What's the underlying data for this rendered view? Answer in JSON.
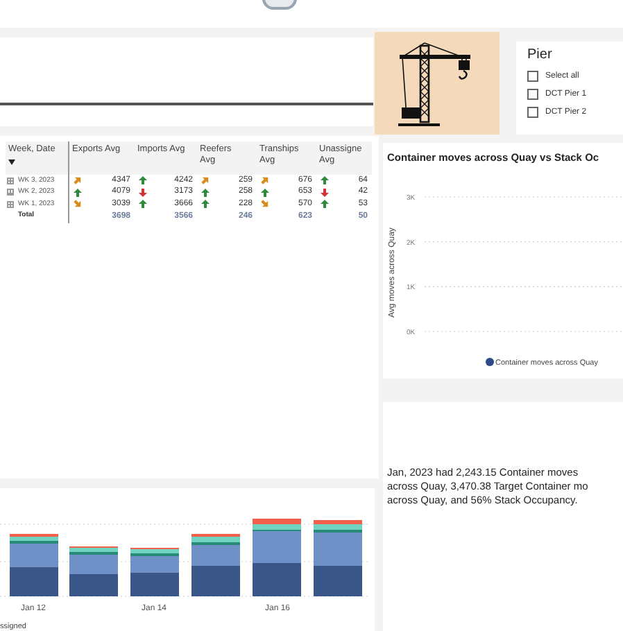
{
  "pier_slicer": {
    "title": "Pier",
    "options": [
      {
        "label": "Select all",
        "checked": false
      },
      {
        "label": "DCT Pier 1",
        "checked": false
      },
      {
        "label": "DCT Pier 2",
        "checked": false
      }
    ]
  },
  "table": {
    "columns": [
      "Week, Date",
      "Exports Avg",
      "Imports Avg",
      "Reefers Avg",
      "Tranships Avg",
      "Unassigne Avg"
    ],
    "rows": [
      {
        "label": "WK 3, 2023",
        "expanded": false,
        "cells": [
          {
            "value": "4347",
            "kind": "rising"
          },
          {
            "value": "4242",
            "kind": "up"
          },
          {
            "value": "259",
            "kind": "rising"
          },
          {
            "value": "676",
            "kind": "rising"
          },
          {
            "value": "64",
            "kind": "up"
          }
        ]
      },
      {
        "label": "WK 2, 2023",
        "expanded": false,
        "cells": [
          {
            "value": "4079",
            "kind": "up"
          },
          {
            "value": "3173",
            "kind": "down"
          },
          {
            "value": "258",
            "kind": "up"
          },
          {
            "value": "653",
            "kind": "up"
          },
          {
            "value": "42",
            "kind": "down"
          }
        ]
      },
      {
        "label": "WK 1, 2023",
        "expanded": false,
        "cells": [
          {
            "value": "3039",
            "kind": "falling"
          },
          {
            "value": "3666",
            "kind": "up"
          },
          {
            "value": "228",
            "kind": "up"
          },
          {
            "value": "570",
            "kind": "falling"
          },
          {
            "value": "53",
            "kind": "up"
          }
        ]
      }
    ],
    "total": {
      "label": "Total",
      "cells": [
        "3698",
        "3566",
        "246",
        "623",
        "50"
      ]
    }
  },
  "line_chart": {
    "chart_data": {
      "type": "line",
      "title": "Container moves across Quay vs Stack Oc",
      "ylabel": "Avg moves across Quay",
      "ylim": [
        0,
        3000
      ],
      "yticks": [
        {
          "value": 0,
          "label": "0K"
        },
        {
          "value": 1000,
          "label": "1K"
        },
        {
          "value": 2000,
          "label": "2K"
        },
        {
          "value": 3000,
          "label": "3K"
        }
      ],
      "series": [
        {
          "name": "Container moves across Quay",
          "color": "#2e4a8a"
        }
      ]
    }
  },
  "narrative": {
    "lines": [
      "Jan, 2023 had 2,243.15 Container moves",
      "across Quay, 3,470.38 Target Container mo",
      "across Quay, and 56% Stack Occupancy."
    ]
  },
  "bar_chart": {
    "x_labels": [
      "Jan 12",
      "Jan 14",
      "Jan 16"
    ],
    "legend_text": "ssigned"
  }
}
